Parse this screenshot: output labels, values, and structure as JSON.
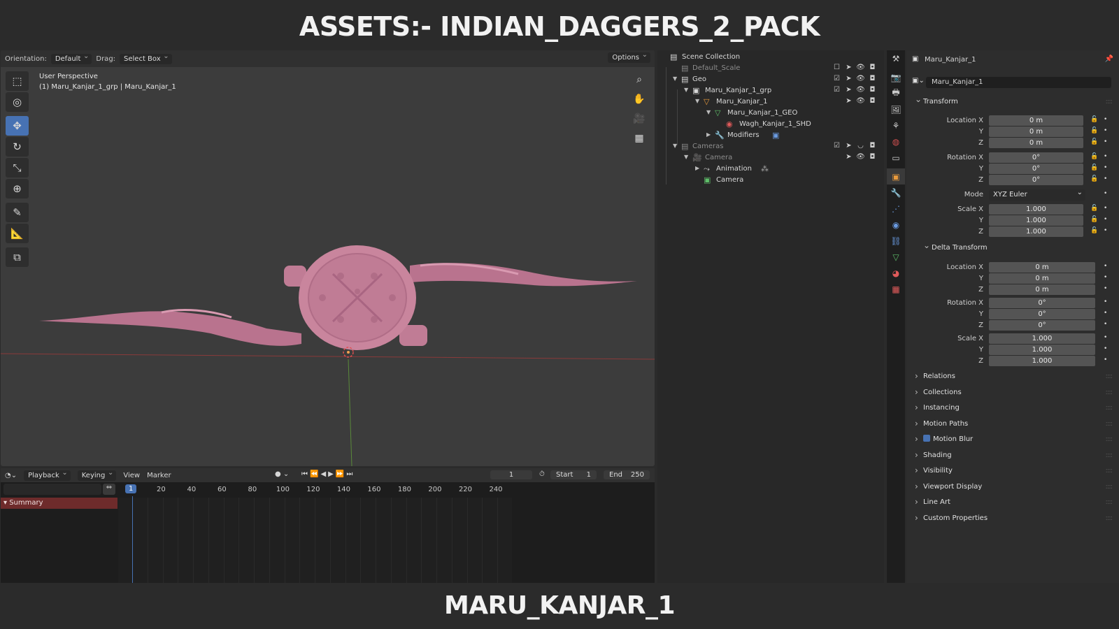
{
  "banner": {
    "top": "ASSETS:- INDIAN_DAGGERS_2_PACK",
    "bottom": "MARU_KANJAR_1"
  },
  "viewport": {
    "orientation_label": "Orientation:",
    "orientation_value": "Default",
    "drag_label": "Drag:",
    "drag_value": "Select Box",
    "options_label": "Options",
    "info_line1": "User Perspective",
    "info_line2": "(1) Maru_Kanjar_1_grp | Maru_Kanjar_1",
    "tools": [
      "select-box-icon",
      "cursor-icon",
      "move-icon",
      "rotate-icon",
      "scale-icon",
      "transform-icon",
      "annotate-icon",
      "measure-icon",
      "add-cube-icon"
    ],
    "nav": [
      "zoom-icon",
      "hand-icon",
      "camera-icon",
      "grid-icon"
    ],
    "object_color": "#c9859d"
  },
  "timeline": {
    "menus": [
      "Playback",
      "Keying",
      "View",
      "Marker"
    ],
    "current_frame": "1",
    "start_label": "Start",
    "start_value": "1",
    "end_label": "End",
    "end_value": "250",
    "ticks": [
      "20",
      "40",
      "60",
      "80",
      "100",
      "120",
      "140",
      "160",
      "180",
      "200",
      "220",
      "240"
    ],
    "playhead": "1",
    "summary": "Summary"
  },
  "outliner": {
    "rows": [
      {
        "label": "Scene Collection"
      },
      {
        "label": "Default_Scale"
      },
      {
        "label": "Geo"
      },
      {
        "label": "Maru_Kanjar_1_grp"
      },
      {
        "label": "Maru_Kanjar_1"
      },
      {
        "label": "Maru_Kanjar_1_GEO"
      },
      {
        "label": "Wagh_Kanjar_1_SHD"
      },
      {
        "label": "Modifiers"
      },
      {
        "label": "Cameras"
      },
      {
        "label": "Camera"
      },
      {
        "label": "Animation"
      },
      {
        "label": "Camera"
      }
    ]
  },
  "properties": {
    "object_name": "Maru_Kanjar_1",
    "data_name": "Maru_Kanjar_1",
    "transform": {
      "title": "Transform",
      "location_label": "Location X",
      "location": [
        "0 m",
        "0 m",
        "0 m"
      ],
      "rotation_label": "Rotation X",
      "rotation": [
        "0°",
        "0°",
        "0°"
      ],
      "mode_label": "Mode",
      "mode_value": "XYZ Euler",
      "scale_label": "Scale X",
      "scale": [
        "1.000",
        "1.000",
        "1.000"
      ]
    },
    "delta": {
      "title": "Delta Transform",
      "location_label": "Location X",
      "location": [
        "0 m",
        "0 m",
        "0 m"
      ],
      "rotation_label": "Rotation X",
      "rotation": [
        "0°",
        "0°",
        "0°"
      ],
      "scale_label": "Scale X",
      "scale": [
        "1.000",
        "1.000",
        "1.000"
      ]
    },
    "axis_y": "Y",
    "axis_z": "Z",
    "panels": [
      "Relations",
      "Collections",
      "Instancing",
      "Motion Paths",
      "Motion Blur",
      "Shading",
      "Visibility",
      "Viewport Display",
      "Line Art",
      "Custom Properties"
    ]
  }
}
